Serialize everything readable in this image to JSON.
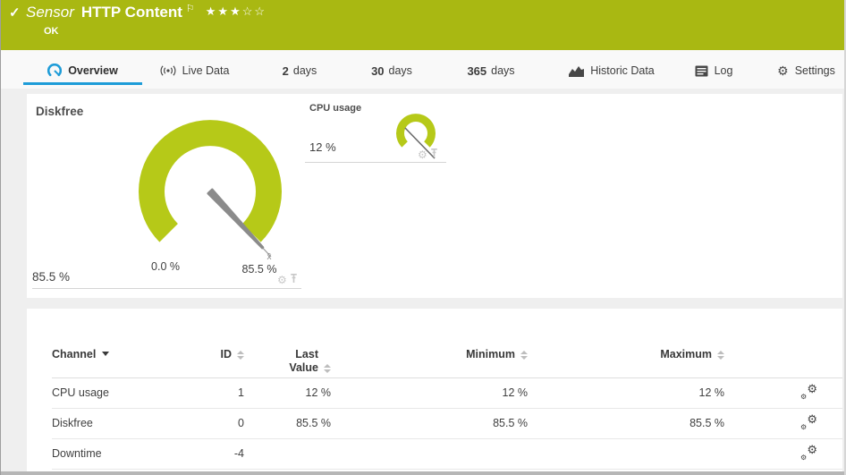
{
  "colors": {
    "header_green": "#a9b812",
    "gauge_green": "#b6c918",
    "accent_blue": "#1e9cd8",
    "needle_gray": "#8b8b8b"
  },
  "window": {
    "kind": "Sensor",
    "title": "HTTP Content",
    "status": "OK",
    "stars": "★★★☆☆",
    "check_glyph": "✓",
    "flag_glyph": "⚐"
  },
  "tabs": {
    "overview": {
      "label": "Overview"
    },
    "live_data": {
      "label": "Live Data"
    },
    "days2": {
      "num": "2",
      "unit": "days"
    },
    "days30": {
      "num": "30",
      "unit": "days"
    },
    "days365": {
      "num": "365",
      "unit": "days"
    },
    "historic": {
      "label": "Historic Data"
    },
    "log": {
      "label": "Log"
    },
    "settings": {
      "label": "Settings",
      "gear_glyph": "⚙"
    }
  },
  "gauges": {
    "diskfree": {
      "title": "Diskfree",
      "value": "85.5 %",
      "scale_min": "0.0 %",
      "scale_max": "85.5 %",
      "avg_marker": "x̄",
      "gear_glyph": "⚙"
    },
    "cpu": {
      "title": "CPU usage",
      "value": "12 %",
      "gear_glyph": "⚙"
    }
  },
  "table": {
    "headers": {
      "channel": "Channel",
      "id": "ID",
      "last_value": "Last Value",
      "minimum": "Minimum",
      "maximum": "Maximum"
    },
    "gear_glyph": "⚙",
    "rows": [
      {
        "channel": "CPU usage",
        "id": "1",
        "last_value": "12 %",
        "minimum": "12 %",
        "maximum": "12 %"
      },
      {
        "channel": "Diskfree",
        "id": "0",
        "last_value": "85.5 %",
        "minimum": "85.5 %",
        "maximum": "85.5 %"
      },
      {
        "channel": "Downtime",
        "id": "-4",
        "last_value": "",
        "minimum": "",
        "maximum": ""
      }
    ]
  }
}
